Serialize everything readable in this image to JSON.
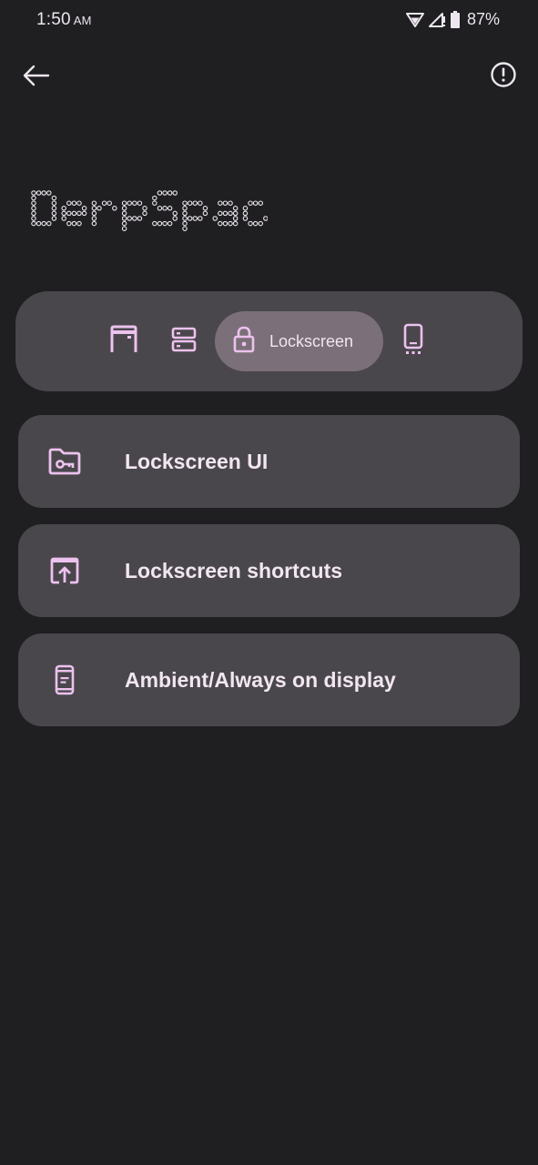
{
  "status_bar": {
    "time": "1:50",
    "ampm": "AM",
    "battery_percent": "87%",
    "icons": [
      "wifi-icon",
      "cellular-signal-icon",
      "battery-icon"
    ]
  },
  "toolbar": {
    "back_icon": "arrow-back-icon",
    "info_icon": "info-circle-icon"
  },
  "logo": {
    "text": "DerpSpace"
  },
  "tabs": [
    {
      "icon": "statusbar-icon",
      "label": "",
      "selected": false
    },
    {
      "icon": "quick-settings-icon",
      "label": "",
      "selected": false
    },
    {
      "icon": "lock-icon",
      "label": "Lockscreen",
      "selected": true
    },
    {
      "icon": "phone-navigation-icon",
      "label": "",
      "selected": false
    }
  ],
  "items": [
    {
      "icon": "folder-key-icon",
      "label": "Lockscreen UI"
    },
    {
      "icon": "open-in-app-icon",
      "label": "Lockscreen shortcuts"
    },
    {
      "icon": "ambient-display-icon",
      "label": "Ambient/Always on display"
    }
  ],
  "colors": {
    "background": "#1f1e21",
    "card": "#4a474c",
    "selected_tab": "#7b7079",
    "accent_icon": "#ecc2ee",
    "text": "#f1e6f1"
  }
}
